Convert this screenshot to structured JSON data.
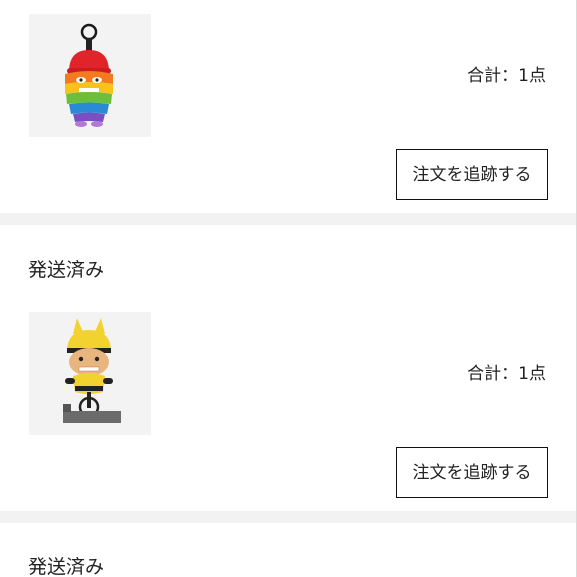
{
  "orders": [
    {
      "status": "",
      "image_icon": "rainbow-plush-keychain",
      "count_label": "合計：1点",
      "track_label": "注文を追跡する"
    },
    {
      "status": "発送済み",
      "image_icon": "bicycle-rider-figure",
      "count_label": "合計：1点",
      "track_label": "注文を追跡する"
    },
    {
      "status": "発送済み"
    }
  ],
  "colors": {
    "separator": "#f2f2f2",
    "thumb_bg": "#f3f3f3",
    "button_border": "#111111",
    "text": "#222222"
  }
}
